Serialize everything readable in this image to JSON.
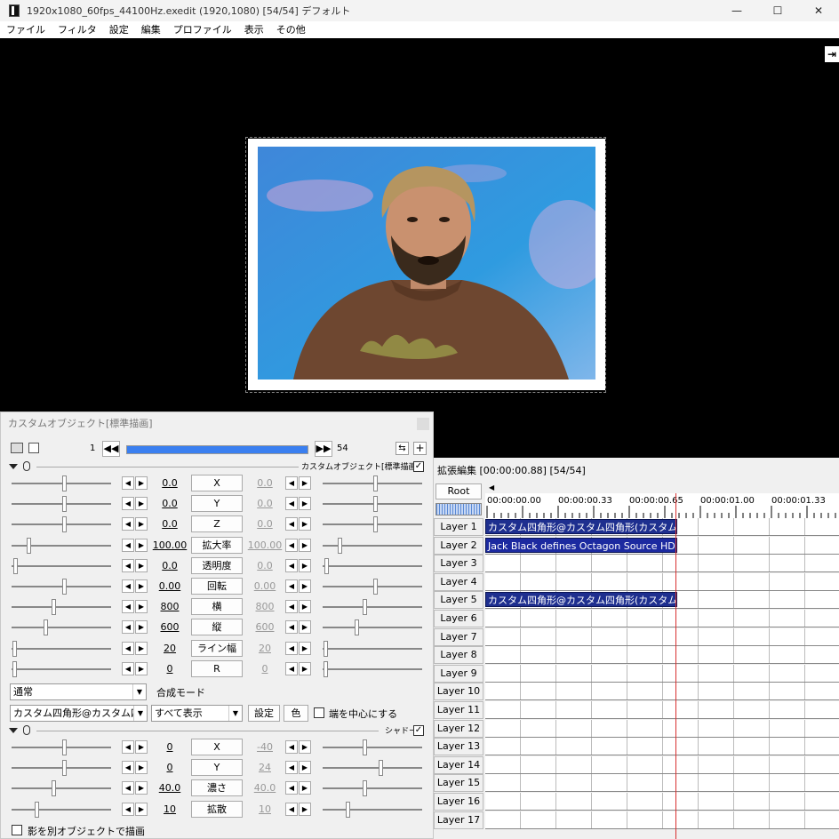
{
  "window": {
    "title": "1920x1080_60fps_44100Hz.exedit (1920,1080)  [54/54]  デフォルト",
    "minimize": "—",
    "maximize": "☐",
    "close": "✕"
  },
  "menu": [
    "ファイル",
    "フィルタ",
    "設定",
    "編集",
    "プロファイル",
    "表示",
    "その他"
  ],
  "preview": {
    "side_button": "⇥"
  },
  "object_panel": {
    "title": "カスタムオブジェクト[標準描画]",
    "frame_start": "1",
    "frame_end": "54",
    "progress": 1.0,
    "section1_label": "カスタムオブジェクト[標準描画]",
    "params": [
      {
        "name": "X",
        "left": "0.0",
        "right": "0.0"
      },
      {
        "name": "Y",
        "left": "0.0",
        "right": "0.0"
      },
      {
        "name": "Z",
        "left": "0.0",
        "right": "0.0"
      },
      {
        "name": "拡大率",
        "left": "100.00",
        "right": "100.00"
      },
      {
        "name": "透明度",
        "left": "0.0",
        "right": "0.0"
      },
      {
        "name": "回転",
        "left": "0.00",
        "right": "0.00"
      },
      {
        "name": "横",
        "left": "800",
        "right": "800"
      },
      {
        "name": "縦",
        "left": "600",
        "right": "600"
      },
      {
        "name": "ライン幅",
        "left": "20",
        "right": "20"
      },
      {
        "name": "R",
        "left": "0",
        "right": "0"
      }
    ],
    "blend_mode_value": "通常",
    "blend_mode_label": "合成モード",
    "custom_object_value": "カスタム四角形@カスタム四角",
    "display_value": "すべて表示",
    "settings_button": "設定",
    "color_button": "色",
    "center_edge_label": "端を中心にする",
    "section2_label": "シャドー",
    "shadow_params": [
      {
        "name": "X",
        "left": "0",
        "right": "-40"
      },
      {
        "name": "Y",
        "left": "0",
        "right": "24"
      },
      {
        "name": "濃さ",
        "left": "40.0",
        "right": "40.0"
      },
      {
        "name": "拡散",
        "left": "10",
        "right": "10"
      }
    ],
    "separate_shadow_label": "影を別オブジェクトで描画"
  },
  "timeline": {
    "title": "拡張編集 [00:00:00.88] [54/54]",
    "root_button": "Root",
    "times": [
      "00:00:00.00",
      "00:00:00.33",
      "00:00:00.65",
      "00:00:01.00",
      "00:00:01.33"
    ],
    "layers": [
      "Layer 1",
      "Layer 2",
      "Layer 3",
      "Layer 4",
      "Layer 5",
      "Layer 6",
      "Layer 7",
      "Layer 8",
      "Layer 9",
      "Layer 10",
      "Layer 11",
      "Layer 12",
      "Layer 13",
      "Layer 14",
      "Layer 15",
      "Layer 16",
      "Layer 17"
    ],
    "clips": {
      "layer1": "カスタム四角形@カスタム四角形(カスタムオブ",
      "layer2": "Jack Black defines Octagon Source HD.",
      "layer5": "カスタム四角形@カスタム四角形(カスタムオブ"
    }
  }
}
